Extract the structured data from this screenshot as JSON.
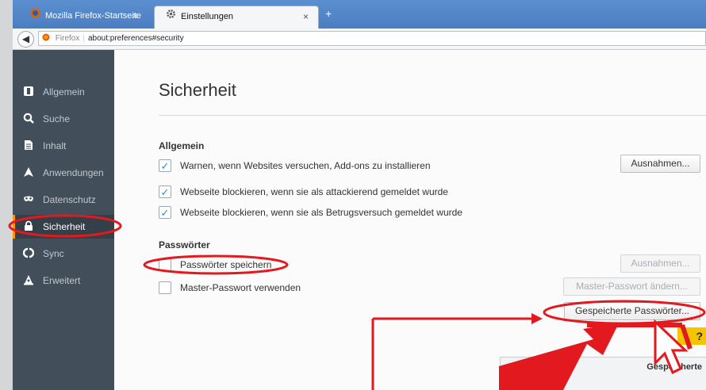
{
  "tabs": [
    {
      "label": "Mozilla Firefox-Startseite",
      "close": "×"
    },
    {
      "label": "Einstellungen",
      "close": "×"
    }
  ],
  "newtab": "+",
  "url": {
    "brand": "Firefox",
    "address": "about:preferences#security"
  },
  "sidebar": {
    "items": [
      {
        "label": "Allgemein"
      },
      {
        "label": "Suche"
      },
      {
        "label": "Inhalt"
      },
      {
        "label": "Anwendungen"
      },
      {
        "label": "Datenschutz"
      },
      {
        "label": "Sicherheit"
      },
      {
        "label": "Sync"
      },
      {
        "label": "Erweitert"
      }
    ],
    "selected": "Sicherheit"
  },
  "main": {
    "title": "Sicherheit",
    "general": {
      "heading": "Allgemein",
      "options": [
        {
          "label": "Warnen, wenn Websites versuchen, Add-ons zu installieren",
          "checked": true
        },
        {
          "label": "Webseite blockieren, wenn sie als attackierend gemeldet wurde",
          "checked": true
        },
        {
          "label": "Webseite blockieren, wenn sie als Betrugsversuch gemeldet wurde",
          "checked": true
        }
      ],
      "exceptions_button": "Ausnahmen..."
    },
    "passwords": {
      "heading": "Passwörter",
      "save_label": "Passwörter speichern",
      "save_checked": false,
      "master_label": "Master-Passwort verwenden",
      "master_checked": false,
      "exceptions_button": "Ausnahmen...",
      "change_master_button": "Master-Passwort ändern...",
      "saved_button": "Gespeicherte Passwörter..."
    },
    "help_badge": "?",
    "dialog_title": "Gespeicherte"
  },
  "colors": {
    "annotation": "#e2191e",
    "accent": "#ff9500",
    "checkmark": "#0996f8"
  }
}
